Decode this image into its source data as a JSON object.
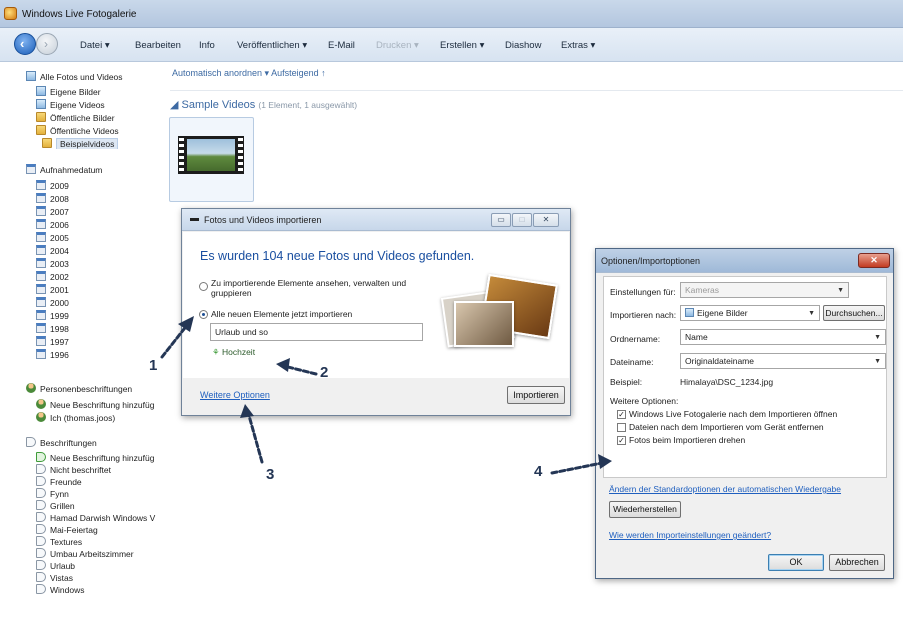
{
  "window": {
    "title": "Windows Live Fotogalerie"
  },
  "menu": {
    "items": [
      {
        "label": "Datei ▾",
        "enabled": true
      },
      {
        "label": "Bearbeiten",
        "enabled": true
      },
      {
        "label": "Info",
        "enabled": true
      },
      {
        "label": "Veröffentlichen ▾",
        "enabled": true
      },
      {
        "label": "E-Mail",
        "enabled": true
      },
      {
        "label": "Drucken ▾",
        "enabled": false
      },
      {
        "label": "Erstellen ▾",
        "enabled": true
      },
      {
        "label": "Diashow",
        "enabled": true
      },
      {
        "label": "Extras ▾",
        "enabled": true
      }
    ]
  },
  "sidebar": {
    "all_label": "Alle Fotos und Videos",
    "folders": [
      "Eigene Bilder",
      "Eigene Videos",
      "Öffentliche Bilder",
      "Öffentliche Videos"
    ],
    "selected_folder": "Beispielvideos",
    "date_header": "Aufnahmedatum",
    "years": [
      "2009",
      "2008",
      "2007",
      "2006",
      "2005",
      "2004",
      "2003",
      "2002",
      "2001",
      "2000",
      "1999",
      "1998",
      "1997",
      "1996"
    ],
    "people_header": "Personenbeschriftungen",
    "people": [
      "Neue Beschriftung hinzufüg",
      "Ich (thomas.joos)"
    ],
    "tags_header": "Beschriftungen",
    "tags": [
      "Neue Beschriftung hinzufüg",
      "Nicht beschriftet",
      "Freunde",
      "Fynn",
      "Grillen",
      "Hamad Darwish Windows V",
      "Mai-Feiertag",
      "Textures",
      "Umbau Arbeitszimmer",
      "Urlaub",
      "Vistas",
      "Windows"
    ]
  },
  "main": {
    "sort_text": "Automatisch anordnen ▾  Aufsteigend ↑",
    "group_title": "Sample Videos",
    "group_sub": "(1 Element, 1 ausgewählt)"
  },
  "import_dialog": {
    "title": "Fotos und Videos importieren",
    "heading": "Es wurden 104 neue Fotos und Videos gefunden.",
    "option1": "Zu importierende Elemente ansehen, verwalten und gruppieren",
    "option2": "Alle neuen Elemente jetzt importieren",
    "name_value": "Urlaub und so",
    "tag_label": "Hochzeit",
    "more_options": "Weitere Optionen",
    "import_button": "Importieren"
  },
  "options_dialog": {
    "title": "Optionen/Importoptionen",
    "settings_for_label": "Einstellungen für:",
    "settings_for_value": "Kameras",
    "import_to_label": "Importieren nach:",
    "import_to_value": "Eigene Bilder",
    "browse_button": "Durchsuchen...",
    "folder_name_label": "Ordnername:",
    "folder_name_value": "Name",
    "file_name_label": "Dateiname:",
    "file_name_value": "Originaldateiname",
    "example_label": "Beispiel:",
    "example_value": "Himalaya\\DSC_1234.jpg",
    "more_options_label": "Weitere Optionen:",
    "checkboxes": [
      {
        "label": "Windows Live Fotogalerie nach dem Importieren öffnen",
        "checked": true
      },
      {
        "label": "Dateien nach dem Importieren vom Gerät entfernen",
        "checked": false
      },
      {
        "label": "Fotos beim Importieren drehen",
        "checked": true
      }
    ],
    "autoplay_link": "Ändern der Standardoptionen der automatischen Wiedergabe",
    "restore_button": "Wiederherstellen",
    "help_link": "Wie werden Importeinstellungen geändert?",
    "ok_button": "OK",
    "cancel_button": "Abbrechen"
  },
  "callouts": [
    "1",
    "2",
    "3",
    "4"
  ],
  "colors": {
    "accent": "#3d6aa3",
    "link": "#1f5fbf",
    "callout": "#243655"
  }
}
